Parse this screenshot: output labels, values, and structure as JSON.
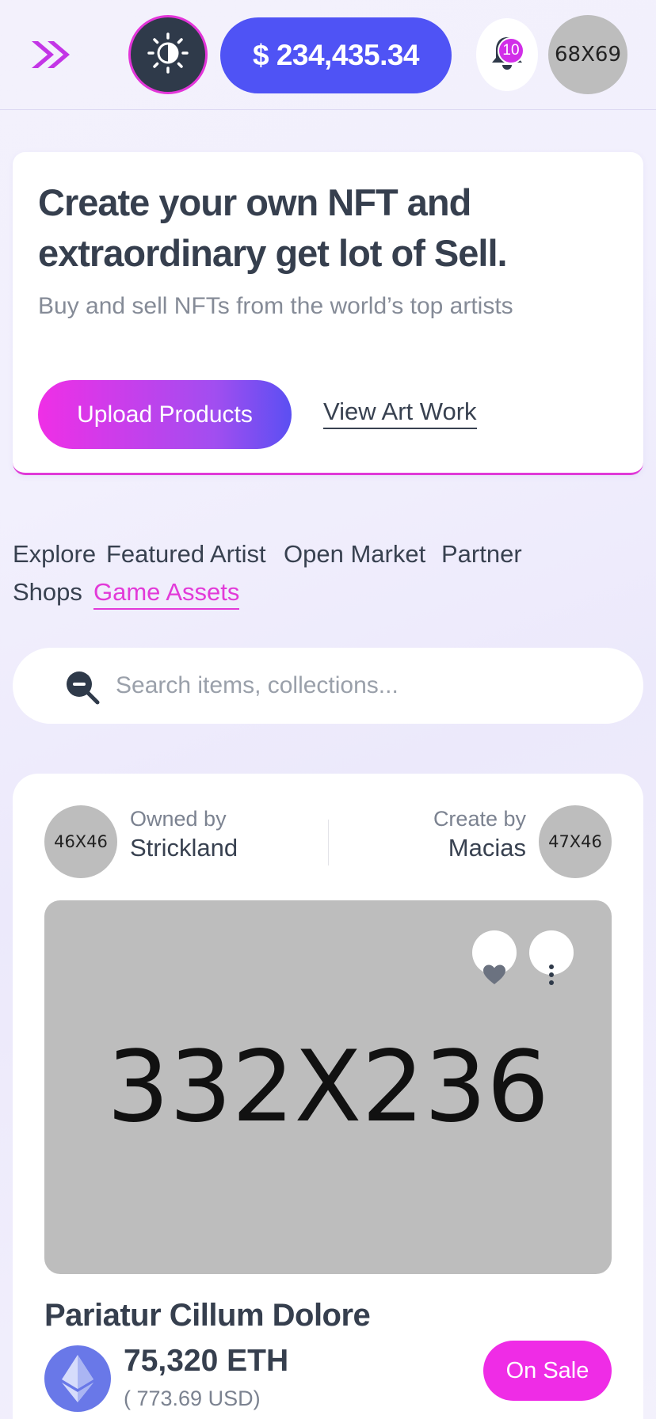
{
  "header": {
    "menu_icon": "double-chevron-right-icon",
    "theme_icon": "sun-icon",
    "balance": "$ 234,435.34",
    "notification_count": "10",
    "notification_icon": "bell-icon",
    "avatar_placeholder": "68X69"
  },
  "hero": {
    "title": "Create your own NFT and extraordinary get lot of Sell.",
    "subtitle": "Buy and sell NFTs from the world’s top artists",
    "upload_label": "Upload Products",
    "view_label": "View Art Work"
  },
  "categories": [
    {
      "label": "Explore",
      "active": false
    },
    {
      "label": "Featured Artist",
      "active": false
    },
    {
      "label": "Open Market",
      "active": false
    },
    {
      "label": "Partner",
      "active": false
    },
    {
      "label": "Shops",
      "active": false
    },
    {
      "label": "Game Assets",
      "active": true
    }
  ],
  "search": {
    "placeholder": "Search items, collections...",
    "value": ""
  },
  "card": {
    "owner_label": "Owned by",
    "owner_name": "Strickland",
    "owner_avatar": "46X46",
    "creator_label": "Create by",
    "creator_name": "Macias",
    "creator_avatar": "47X46",
    "media_placeholder": "332X236",
    "title": "Pariatur Cillum Dolore",
    "price_eth": "75,320 ETH",
    "price_usd": "( 773.69 USD)",
    "sale_label": "On Sale"
  },
  "colors": {
    "accent_pink": "#ef2ce6",
    "accent_blue": "#4f53f5",
    "text_dark": "#363f4e"
  }
}
